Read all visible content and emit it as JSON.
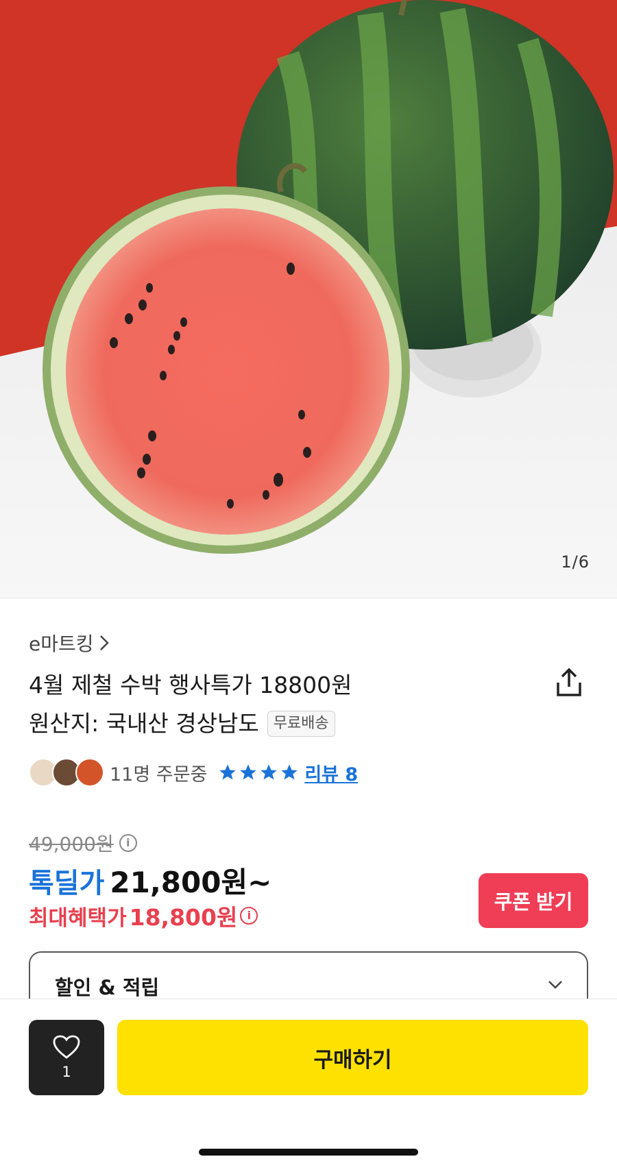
{
  "hero": {
    "counter": "1/6",
    "description_icon": "watermark-product-photo"
  },
  "product": {
    "seller": "e마트킹",
    "title_line1": "4월 제철 수박 행사특가 18800원",
    "title_line2": "원산지: 국내산 경상남도",
    "badge": "무료배송"
  },
  "social": {
    "orders": "11명 주문중",
    "rating_stars": 4,
    "reviews": "리뷰 8"
  },
  "pricing": {
    "original": "49,000원",
    "deal_label": "톡딜가",
    "deal_price": "21,800원~",
    "max_label": "최대혜택가",
    "max_price": "18,800원",
    "coupon_button": "쿠폰 받기"
  },
  "discount": {
    "label": "할인 & 적립"
  },
  "bottom": {
    "like_count": "1",
    "buy_button": "구매하기"
  },
  "colors": {
    "accent_blue": "#1a73d9",
    "accent_red": "#ef3e56",
    "buy_yellow": "#ffe100"
  }
}
